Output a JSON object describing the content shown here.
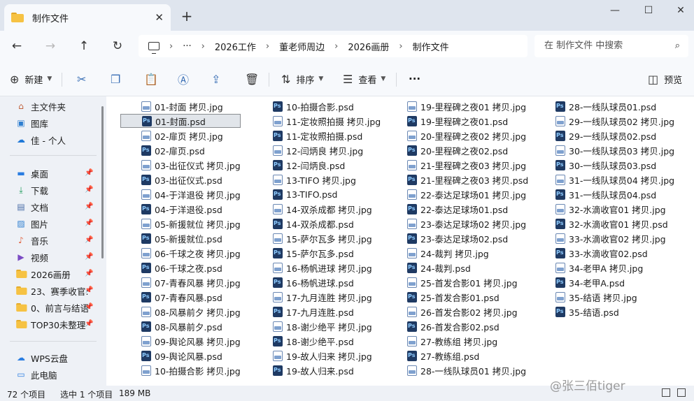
{
  "window": {
    "tab_title": "制作文件",
    "new_tab_glyph": "+",
    "tab_close_glyph": "✕",
    "controls": {
      "minimize": "—",
      "maximize": "☐",
      "close": "✕"
    }
  },
  "nav": {
    "back": "←",
    "forward": "→",
    "up": "↑",
    "refresh": "↻"
  },
  "address": {
    "more": "···",
    "separator": "›",
    "segments": [
      "2026工作",
      "董老师周边",
      "2026画册",
      "制作文件"
    ]
  },
  "search": {
    "placeholder": "在 制作文件 中搜索",
    "icon": "search-icon"
  },
  "toolbar": {
    "new_label": "新建",
    "sort_label": "排序",
    "view_label": "查看",
    "more_glyph": "···",
    "preview_label": "预览"
  },
  "sidebar": {
    "quick": [
      {
        "label": "主文件夹",
        "icon": "home-icon"
      },
      {
        "label": "图库",
        "icon": "gallery-icon"
      },
      {
        "label": "佳 - 个人",
        "icon": "onedrive-icon"
      }
    ],
    "pinned": [
      {
        "label": "桌面",
        "icon": "desktop-icon"
      },
      {
        "label": "下载",
        "icon": "download-icon"
      },
      {
        "label": "文档",
        "icon": "document-icon"
      },
      {
        "label": "图片",
        "icon": "pictures-icon"
      },
      {
        "label": "音乐",
        "icon": "music-icon"
      },
      {
        "label": "视频",
        "icon": "video-icon"
      },
      {
        "label": "2026画册",
        "icon": "folder-icon"
      },
      {
        "label": "23、赛季收官:",
        "icon": "folder-icon"
      },
      {
        "label": "0、前言与结语",
        "icon": "folder-icon"
      },
      {
        "label": "TOP30未整理",
        "icon": "folder-icon"
      }
    ],
    "other": [
      {
        "label": "WPS云盘",
        "icon": "cloud-icon"
      },
      {
        "label": "此电脑",
        "icon": "computer-icon"
      }
    ],
    "pin_glyph": "📌"
  },
  "files": {
    "columns": [
      [
        {
          "name": "01-封面 拷贝.jpg",
          "type": "jpg"
        },
        {
          "name": "01-封面.psd",
          "type": "psd",
          "selected": true
        },
        {
          "name": "02-扉页 拷贝.jpg",
          "type": "jpg"
        },
        {
          "name": "02-扉页.psd",
          "type": "psd"
        },
        {
          "name": "03-出征仪式 拷贝.jpg",
          "type": "jpg"
        },
        {
          "name": "03-出征仪式.psd",
          "type": "psd"
        },
        {
          "name": "04-于洋退役 拷贝.jpg",
          "type": "jpg"
        },
        {
          "name": "04-于洋退役.psd",
          "type": "psd"
        },
        {
          "name": "05-新援就位 拷贝.jpg",
          "type": "jpg"
        },
        {
          "name": "05-新援就位.psd",
          "type": "psd"
        },
        {
          "name": "06-千球之夜 拷贝.jpg",
          "type": "jpg"
        },
        {
          "name": "06-千球之夜.psd",
          "type": "psd"
        },
        {
          "name": "07-青春风暴 拷贝.jpg",
          "type": "jpg"
        },
        {
          "name": "07-青春风暴.psd",
          "type": "psd"
        },
        {
          "name": "08-风暴前夕 拷贝.jpg",
          "type": "jpg"
        },
        {
          "name": "08-风暴前夕.psd",
          "type": "psd"
        },
        {
          "name": "09-舆论风暴 拷贝.jpg",
          "type": "jpg"
        },
        {
          "name": "09-舆论风暴.psd",
          "type": "psd"
        },
        {
          "name": "10-拍摄合影 拷贝.jpg",
          "type": "jpg"
        }
      ],
      [
        {
          "name": "10-拍摄合影.psd",
          "type": "psd"
        },
        {
          "name": "11-定妆照拍摄 拷贝.jpg",
          "type": "jpg"
        },
        {
          "name": "11-定妆照拍摄.psd",
          "type": "psd"
        },
        {
          "name": "12-闫炳良 拷贝.jpg",
          "type": "jpg"
        },
        {
          "name": "12-闫炳良.psd",
          "type": "psd"
        },
        {
          "name": "13-TIFO 拷贝.jpg",
          "type": "jpg"
        },
        {
          "name": "13-TIFO.psd",
          "type": "psd"
        },
        {
          "name": "14-双杀成都 拷贝.jpg",
          "type": "jpg"
        },
        {
          "name": "14-双杀成都.psd",
          "type": "psd"
        },
        {
          "name": "15-萨尔瓦多 拷贝.jpg",
          "type": "jpg"
        },
        {
          "name": "15-萨尔瓦多.psd",
          "type": "psd"
        },
        {
          "name": "16-杨帆进球 拷贝.jpg",
          "type": "jpg"
        },
        {
          "name": "16-杨帆进球.psd",
          "type": "psd"
        },
        {
          "name": "17-九月连胜 拷贝.jpg",
          "type": "jpg"
        },
        {
          "name": "17-九月连胜.psd",
          "type": "psd"
        },
        {
          "name": "18-谢少绝平 拷贝.jpg",
          "type": "jpg"
        },
        {
          "name": "18-谢少绝平.psd",
          "type": "psd"
        },
        {
          "name": "19-故人归来 拷贝.jpg",
          "type": "jpg"
        },
        {
          "name": "19-故人归来.psd",
          "type": "psd"
        }
      ],
      [
        {
          "name": "19-里程碑之夜01 拷贝.jpg",
          "type": "jpg"
        },
        {
          "name": "19-里程碑之夜01.psd",
          "type": "psd"
        },
        {
          "name": "20-里程碑之夜02 拷贝.jpg",
          "type": "jpg"
        },
        {
          "name": "20-里程碑之夜02.psd",
          "type": "psd"
        },
        {
          "name": "21-里程碑之夜03 拷贝.jpg",
          "type": "jpg"
        },
        {
          "name": "21-里程碑之夜03 拷贝.psd",
          "type": "psd"
        },
        {
          "name": "22-泰达足球场01 拷贝.jpg",
          "type": "jpg"
        },
        {
          "name": "22-泰达足球场01.psd",
          "type": "psd"
        },
        {
          "name": "23-泰达足球场02 拷贝.jpg",
          "type": "jpg"
        },
        {
          "name": "23-泰达足球场02.psd",
          "type": "psd"
        },
        {
          "name": "24-裁判 拷贝.jpg",
          "type": "jpg"
        },
        {
          "name": "24-裁判.psd",
          "type": "psd"
        },
        {
          "name": "25-首发合影01 拷贝.jpg",
          "type": "jpg"
        },
        {
          "name": "25-首发合影01.psd",
          "type": "psd"
        },
        {
          "name": "26-首发合影02 拷贝.jpg",
          "type": "jpg"
        },
        {
          "name": "26-首发合影02.psd",
          "type": "psd"
        },
        {
          "name": "27-教练组 拷贝.jpg",
          "type": "jpg"
        },
        {
          "name": "27-教练组.psd",
          "type": "psd"
        },
        {
          "name": "28-一线队球员01 拷贝.jpg",
          "type": "jpg"
        }
      ],
      [
        {
          "name": "28-一线队球员01.psd",
          "type": "psd"
        },
        {
          "name": "29-一线队球员02 拷贝.jpg",
          "type": "jpg"
        },
        {
          "name": "29-一线队球员02.psd",
          "type": "psd"
        },
        {
          "name": "30-一线队球员03 拷贝.jpg",
          "type": "jpg"
        },
        {
          "name": "30-一线队球员03.psd",
          "type": "psd"
        },
        {
          "name": "31-一线队球员04 拷贝.jpg",
          "type": "jpg"
        },
        {
          "name": "31-一线队球员04.psd",
          "type": "psd"
        },
        {
          "name": "32-水滴收官01 拷贝.jpg",
          "type": "jpg"
        },
        {
          "name": "32-水滴收官01 拷贝.psd",
          "type": "psd"
        },
        {
          "name": "33-水滴收官02 拷贝.jpg",
          "type": "jpg"
        },
        {
          "name": "33-水滴收官02.psd",
          "type": "psd"
        },
        {
          "name": "34-老甲A 拷贝.jpg",
          "type": "jpg"
        },
        {
          "name": "34-老甲A.psd",
          "type": "psd"
        },
        {
          "name": "35-结语 拷贝.jpg",
          "type": "jpg"
        },
        {
          "name": "35-结语.psd",
          "type": "psd"
        }
      ]
    ]
  },
  "status": {
    "item_count": "72 个项目",
    "selection": "选中 1 个项目",
    "size": "189 MB"
  },
  "watermark": "@张三佰tiger"
}
